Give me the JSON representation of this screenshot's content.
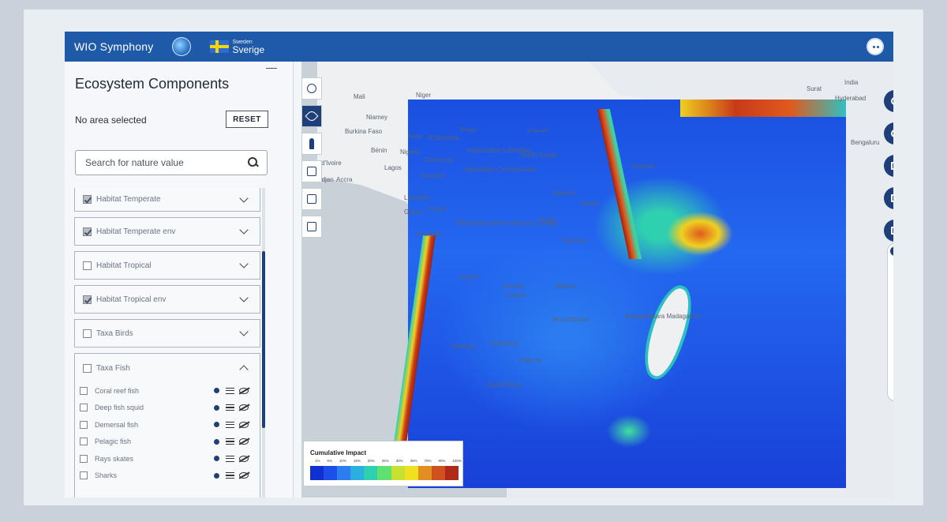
{
  "header": {
    "app_title": "WIO Symphony",
    "country_small": "Sweden",
    "country_name": "Sverige"
  },
  "sidebar": {
    "title": "Ecosystem Components",
    "area_status": "No area selected",
    "reset_label": "RESET",
    "search_placeholder": "Search for nature value",
    "categories": [
      {
        "label": "Habitat Temperate",
        "checked": true
      },
      {
        "label": "Habitat Temperate env",
        "checked": true
      },
      {
        "label": "Habitat Tropical",
        "checked": false
      },
      {
        "label": "Habitat Tropical env",
        "checked": true
      },
      {
        "label": "Taxa Birds",
        "checked": false
      },
      {
        "label": "Taxa Fish",
        "checked": false,
        "expanded": true
      }
    ],
    "fish_items": [
      "Coral reef fish",
      "Deep fish squid",
      "Demersal fish",
      "Pelagic fish",
      "Rays skates",
      "Sharks"
    ]
  },
  "map": {
    "labels": [
      "Mali",
      "Niger",
      "Niamey",
      "Burkina Faso",
      "Kano",
      "N'Djaména",
      "Tchad",
      "السودان",
      "Bénin",
      "Nigeria",
      "Abidjan",
      "Accra",
      "Lagos",
      "Cameroun",
      "Yaoundé",
      "Ködörösêse tî Bêafrîka",
      "République Centrafricaine",
      "South Sudan",
      "Libreville",
      "Gabon",
      "Congo",
      "République démocratique du Congo",
      "Kinshasa",
      "Uganda",
      "Kenya",
      "Kigali",
      "Tanzania",
      "Angola",
      "Zambia",
      "Lusaka",
      "Malawi",
      "Namibia",
      "Botswana",
      "Moçambique",
      "Pretoria",
      "South Africa",
      "Madagasikara Madagascar",
      "India",
      "Hyderabad",
      "Bengaluru",
      "Surat",
      "Somaali",
      "Côte d'Ivoire"
    ]
  },
  "legend": {
    "title": "Cumulative Impact",
    "ticks": [
      "1%",
      "5%",
      "10%",
      "15%",
      "20%",
      "25%",
      "30%",
      "35%",
      "70%",
      "90%",
      "100%"
    ],
    "colors": [
      "#1030d0",
      "#1c4fe8",
      "#2d7cf0",
      "#2ab0e0",
      "#2fd0b0",
      "#5fe070",
      "#c8e030",
      "#f0e020",
      "#e09020",
      "#d05020",
      "#b02a18"
    ]
  },
  "tools": [
    "globe-icon",
    "leaf-icon",
    "person-icon",
    "calculator-icon",
    "report-icon",
    "table-icon"
  ],
  "controls": [
    "zoom-in-icon",
    "zoom-out-icon",
    "layers-icon",
    "select-area-icon",
    "chart-icon"
  ]
}
